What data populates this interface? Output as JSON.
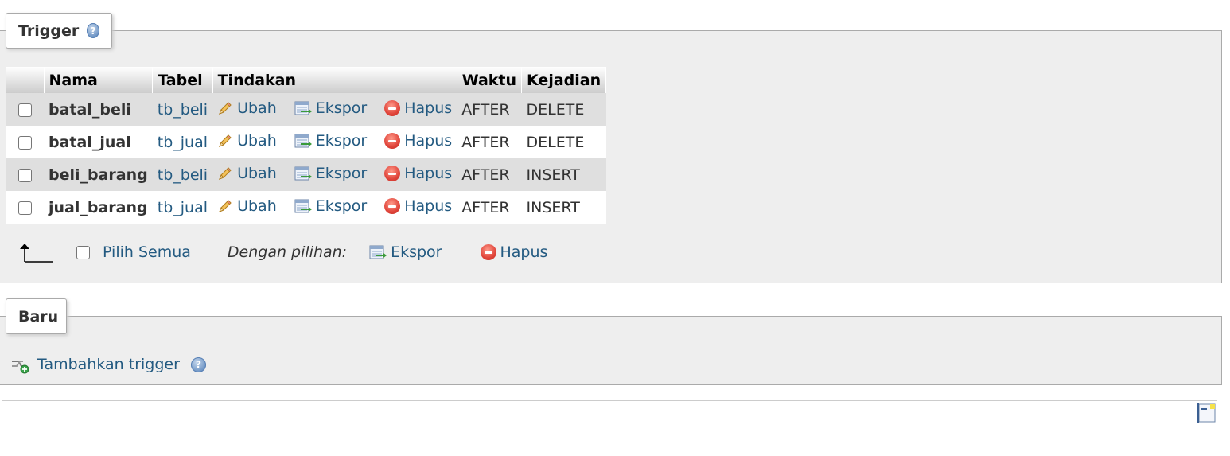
{
  "trigger_section": {
    "title": "Trigger",
    "columns": [
      "Nama",
      "Tabel",
      "Tindakan",
      "Waktu",
      "Kejadian"
    ],
    "rows": [
      {
        "name": "batal_beli",
        "table": "tb_beli",
        "edit": "Ubah",
        "export": "Ekspor",
        "delete": "Hapus",
        "time": "AFTER",
        "event": "DELETE"
      },
      {
        "name": "batal_jual",
        "table": "tb_jual",
        "edit": "Ubah",
        "export": "Ekspor",
        "delete": "Hapus",
        "time": "AFTER",
        "event": "DELETE"
      },
      {
        "name": "beli_barang",
        "table": "tb_beli",
        "edit": "Ubah",
        "export": "Ekspor",
        "delete": "Hapus",
        "time": "AFTER",
        "event": "INSERT"
      },
      {
        "name": "jual_barang",
        "table": "tb_jual",
        "edit": "Ubah",
        "export": "Ekspor",
        "delete": "Hapus",
        "time": "AFTER",
        "event": "INSERT"
      }
    ],
    "select_all_label": "Pilih Semua",
    "with_selected_label": "Dengan pilihan:",
    "bulk_export_label": "Ekspor",
    "bulk_delete_label": "Hapus"
  },
  "new_section": {
    "title": "Baru",
    "add_trigger_label": "Tambahkan trigger"
  },
  "icons": {
    "help": "help-icon",
    "edit": "pencil-icon",
    "export": "export-icon",
    "delete": "delete-icon",
    "add": "add-trigger-icon",
    "arrow": "arrow-up-left-icon",
    "console": "console-icon"
  },
  "colors": {
    "link": "#235a81",
    "panel_bg": "#eeeeee",
    "row_odd": "#dfdfdf",
    "row_even": "#ffffff"
  }
}
